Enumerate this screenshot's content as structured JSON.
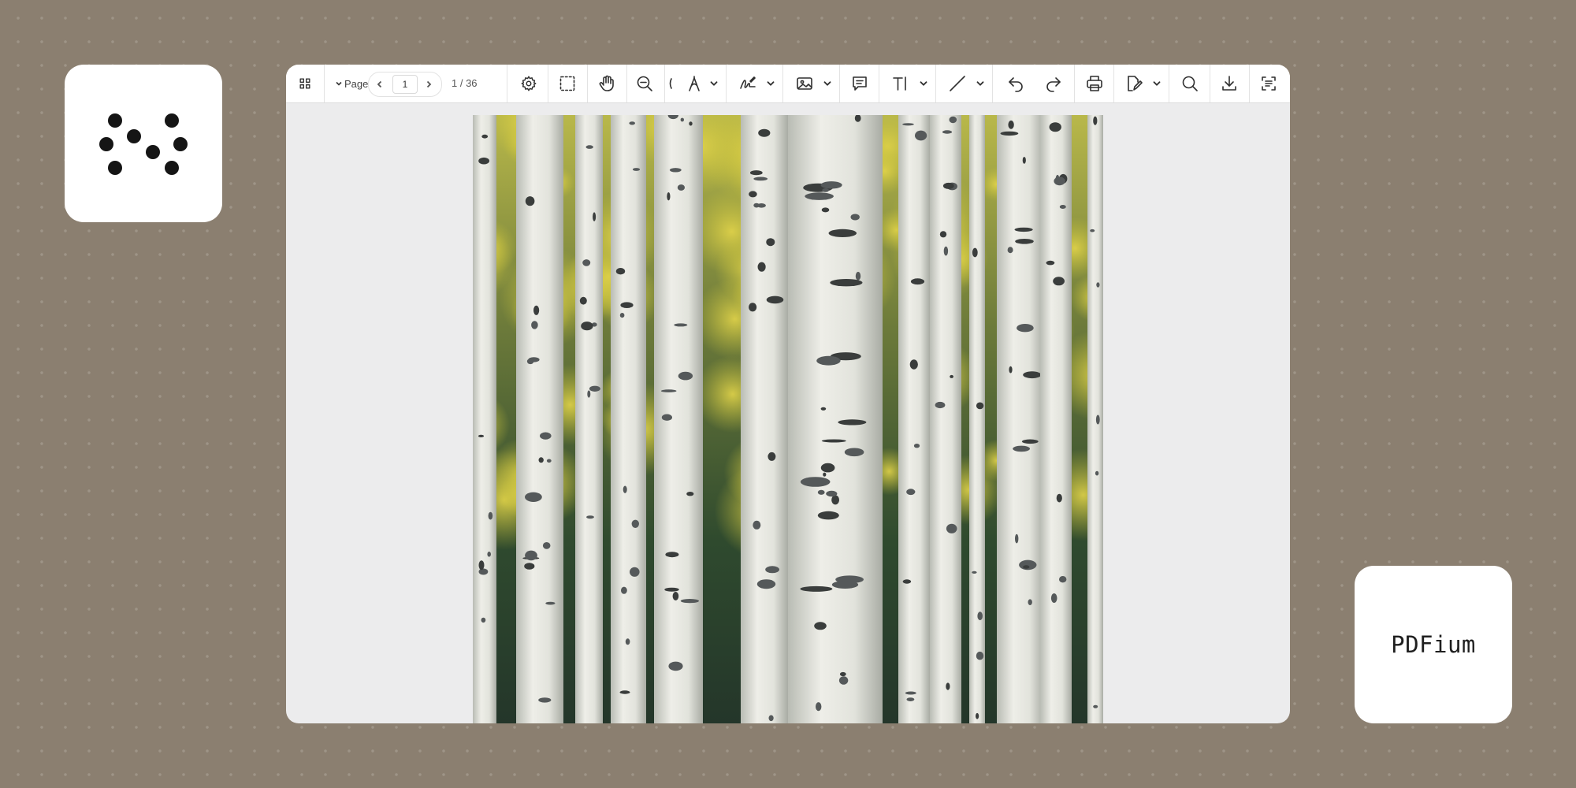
{
  "brand": {
    "card_text": "PDFium"
  },
  "toolbar": {
    "page_label": "Page",
    "current_page": "1",
    "page_total": "1 / 36",
    "tools": [
      "thumbnails-icon",
      "settings-icon",
      "marquee-select-icon",
      "pan-hand-icon",
      "zoom-out-icon",
      "ink-pen-icon",
      "signature-icon",
      "image-icon",
      "comment-icon",
      "text-tool-icon",
      "line-icon",
      "undo-icon",
      "redo-icon",
      "print-icon",
      "edit-icon",
      "search-icon",
      "download-icon",
      "document-properties-icon"
    ]
  },
  "document": {
    "page_subject": "birch-forest-photo"
  },
  "colors": {
    "background": "#8b7f70",
    "card": "#ffffff",
    "viewer_bg": "#ececed"
  }
}
